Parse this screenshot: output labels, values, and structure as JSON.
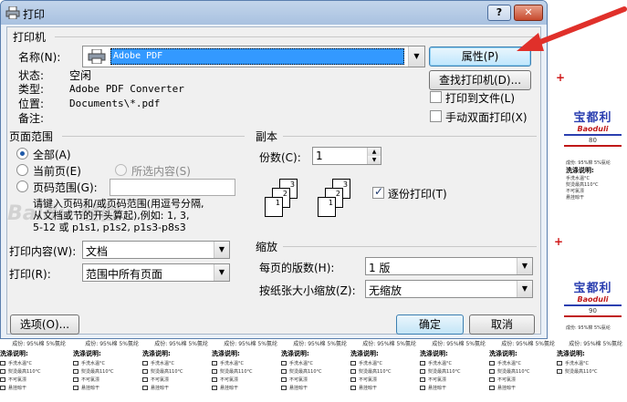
{
  "window": {
    "title": "打印",
    "help_button": "?",
    "close_button": "✕"
  },
  "printer": {
    "group_label": "打印机",
    "name_label": "名称(N):",
    "selected": "Adobe PDF",
    "properties_button": "属性(P)",
    "find_button": "查找打印机(D)...",
    "status_label": "状态:",
    "status_value": "空闲",
    "type_label": "类型:",
    "type_value": "Adobe PDF Converter",
    "where_label": "位置:",
    "where_value": "Documents\\*.pdf",
    "comment_label": "备注:",
    "print_to_file": {
      "label": "打印到文件(L)",
      "checked": false
    },
    "manual_duplex": {
      "label": "手动双面打印(X)",
      "checked": false
    }
  },
  "page_range": {
    "group_label": "页面范围",
    "options": [
      {
        "label": "全部(A)",
        "selected": true
      },
      {
        "label": "当前页(E)",
        "selected": false
      },
      {
        "label": "所选内容(S)",
        "selected": false,
        "disabled": true
      },
      {
        "label": "页码范围(G):",
        "selected": false
      }
    ],
    "hint": "请键入页码和/或页码范围(用逗号分隔,\n从文档或节的开头算起),例如: 1, 3,\n5-12 或 p1s1, p1s2, p1s3-p8s3"
  },
  "copies": {
    "group_label": "副本",
    "count_label": "份数(C):",
    "count_value": "1",
    "collate": {
      "label": "逐份打印(T)",
      "checked": true
    },
    "icon_numbers": [
      "1",
      "2",
      "3"
    ]
  },
  "print_what": {
    "label": "打印内容(W):",
    "value": "文档"
  },
  "print_scope": {
    "label": "打印(R):",
    "value": "范围中所有页面"
  },
  "zoom": {
    "group_label": "缩放",
    "pages_per_sheet_label": "每页的版数(H):",
    "pages_per_sheet_value": "1 版",
    "scale_label": "按纸张大小缩放(Z):",
    "scale_value": "无缩放"
  },
  "footer": {
    "options_button": "选项(O)...",
    "ok_button": "确定",
    "cancel_button": "取消"
  },
  "background": {
    "brand_cn": "宝都利",
    "brand_en": "Baoduli",
    "numbers": [
      "80",
      "90"
    ],
    "composition": "成份: 95%棉 5%氨纶",
    "wash_title": "洗涤说明:",
    "wash_lines": [
      "手洗水温°C",
      "熨烫最高110°C",
      "不可氯漂",
      "悬挂晾干"
    ],
    "watermark": "Baidu 经验"
  },
  "colors": {
    "selection": "#3399ff",
    "brand_blue": "#2b3fb0",
    "brand_red": "#c01818",
    "arrow": "#e0302a"
  }
}
